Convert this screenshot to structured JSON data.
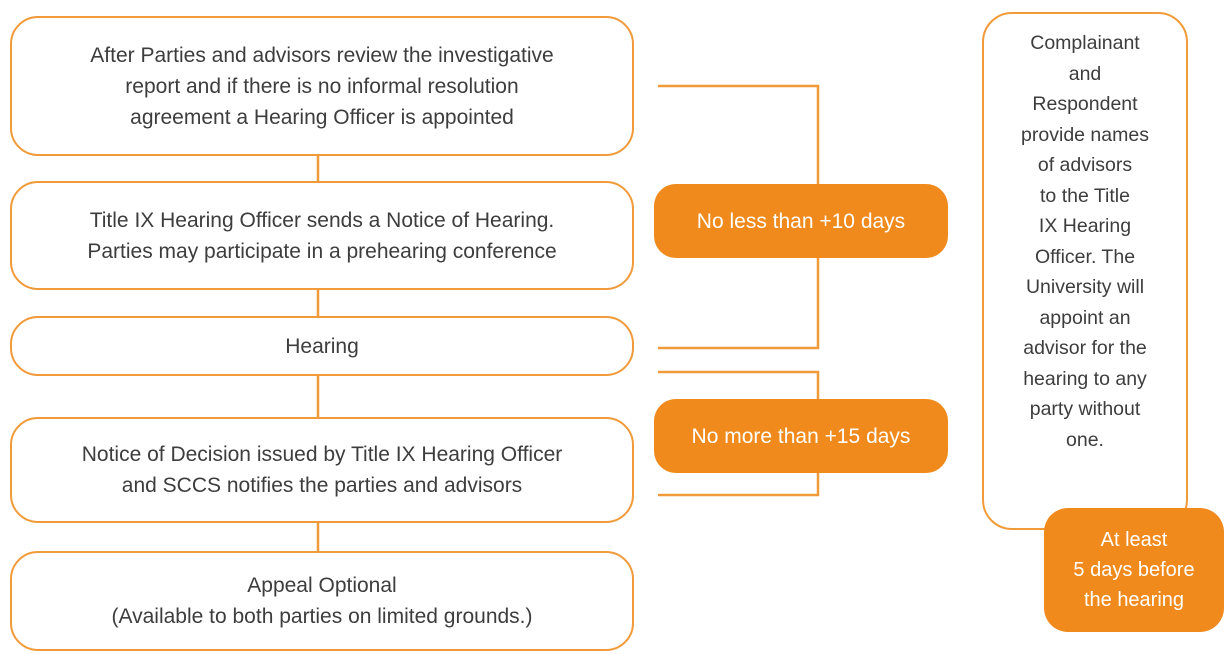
{
  "steps": [
    {
      "text": "After Parties and advisors review the investigative\nreport and if there is no informal resolution\nagreement a Hearing Officer is appointed"
    },
    {
      "text": "Title IX Hearing Officer sends a Notice of Hearing.\nParties may participate in a prehearing conference"
    },
    {
      "text": "Hearing"
    },
    {
      "text": "Notice of Decision issued by Title IX Hearing Officer\nand SCCS notifies the parties and advisors"
    },
    {
      "text": "Appeal Optional\n(Available to both parties on limited grounds.)"
    }
  ],
  "timeframes": {
    "before_hearing": "No less than +10 days",
    "after_hearing": "No more than +15 days"
  },
  "side_note": {
    "text": "Complainant\nand\nRespondent\nprovide names\nof advisors\nto the Title\nIX Hearing\nOfficer. The\nUniversity will\nappoint an\nadvisor for the\nhearing to any\nparty without\none.",
    "deadline": "At least\n5 days before\nthe hearing"
  },
  "colors": {
    "accent": "#f08a1c",
    "border": "#f19a3a",
    "text": "#3d3d3d"
  }
}
